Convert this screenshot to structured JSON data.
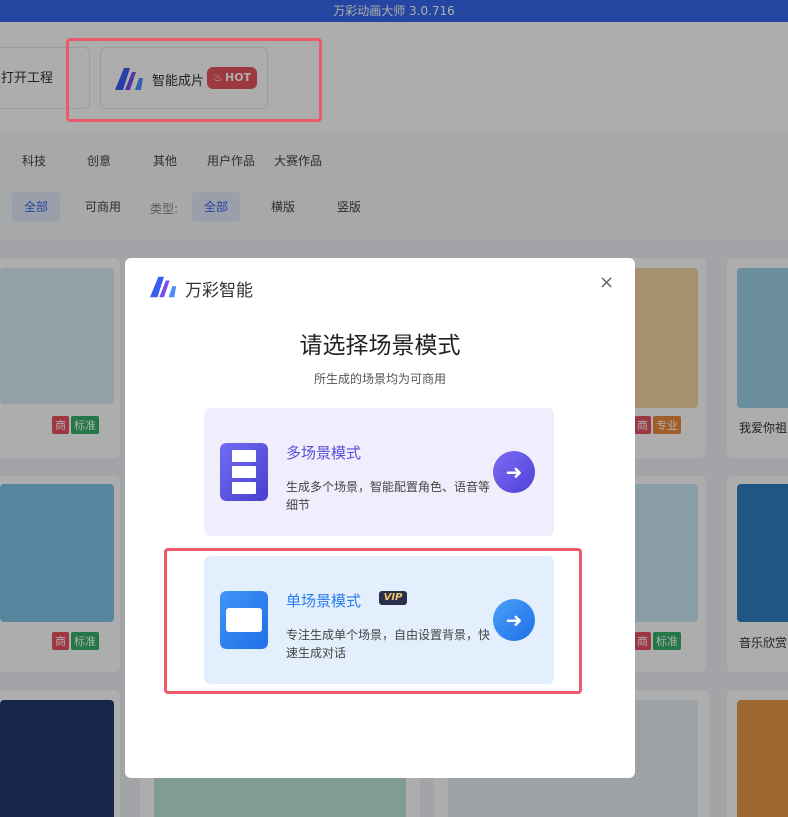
{
  "titlebar": {
    "title": "万彩动画大师 3.0.716"
  },
  "toolbar": {
    "open_project": "打开工程",
    "smart_create": "智能成片",
    "hot_badge": "HOT"
  },
  "filters": {
    "categories": [
      "科技",
      "创意",
      "其他",
      "用户作品",
      "大赛作品"
    ],
    "license_chips": [
      "全部",
      "可商用"
    ],
    "type_label": "类型:",
    "type_chips": [
      "全部",
      "横版",
      "竖版"
    ]
  },
  "cards": [
    {
      "tags": [
        "商",
        "标准"
      ]
    },
    {
      "tags": [
        "商",
        "专业"
      ]
    },
    {
      "title": "我爱你祖"
    },
    {
      "tags": [
        "商",
        "标准"
      ]
    },
    {
      "tags": [
        "商",
        "标准"
      ]
    },
    {
      "title": "音乐欣赏"
    }
  ],
  "modal": {
    "brand": "万彩智能",
    "close_icon": "×",
    "heading": "请选择场景模式",
    "subheading": "所生成的场景均为可商用",
    "modes": [
      {
        "title": "多场景模式",
        "description": "生成多个场景，智能配置角色、语音等细节",
        "icon": "film-strip-icon"
      },
      {
        "title": "单场景模式",
        "badge": "VIP",
        "description": "专注生成单个场景，自由设置背景，快速生成对话",
        "icon": "single-frame-icon"
      }
    ]
  },
  "colors": {
    "titlebar": "#3768ec",
    "highlight": "#ec5a6a",
    "multi_accent": "#5a4fd6",
    "single_accent": "#2a7df0"
  }
}
